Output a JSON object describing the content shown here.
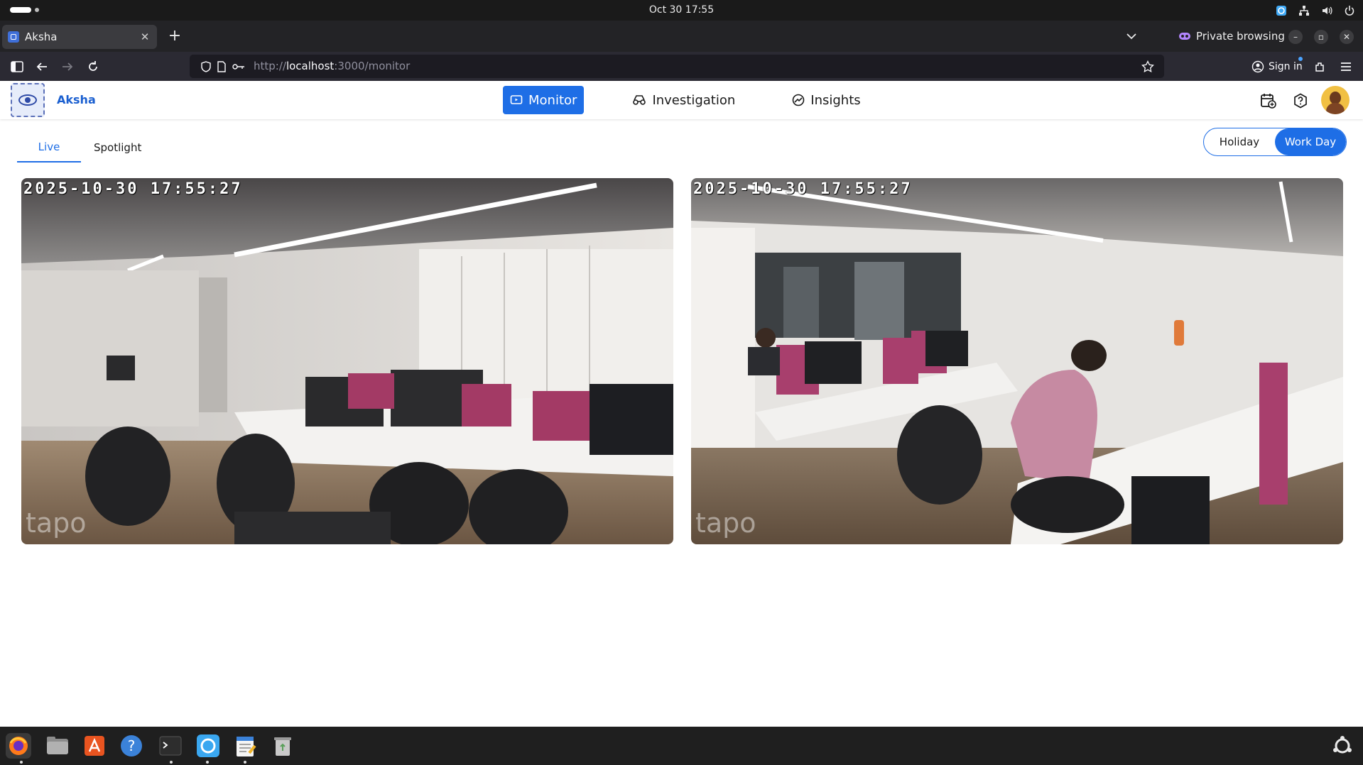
{
  "os": {
    "clock": "Oct 30  17:55"
  },
  "browser": {
    "tab_title": "Aksha",
    "tab_close": "✕",
    "new_tab": "+",
    "private_label": "Private browsing",
    "url_scheme": "http://",
    "url_host": "localhost",
    "url_rest": ":3000/monitor",
    "sign_in": "Sign in"
  },
  "app": {
    "brand": "Aksha",
    "nav": [
      {
        "label": "Monitor",
        "icon": "monitor-icon",
        "active": true
      },
      {
        "label": "Investigation",
        "icon": "investigation-icon",
        "active": false
      },
      {
        "label": "Insights",
        "icon": "insights-icon",
        "active": false
      }
    ],
    "subtabs": [
      {
        "label": "Live",
        "active": true
      },
      {
        "label": "Spotlight",
        "active": false
      }
    ],
    "schedule_toggle": {
      "options": [
        "Holiday",
        "Work Day"
      ],
      "selected": "Work Day"
    },
    "accent_color": "#1e6ee6"
  },
  "feeds": [
    {
      "timestamp": "2025-10-30 17:55:27",
      "watermark": "tapo"
    },
    {
      "timestamp": "2025-10-30 17:55:27",
      "watermark": "tapo"
    }
  ],
  "taskbar": {
    "apps": [
      "firefox-icon",
      "files-icon",
      "app-center-icon",
      "help-icon",
      "terminal-icon",
      "remote-desktop-icon",
      "text-editor-icon",
      "trash-icon"
    ],
    "show_apps": "show-apps-icon"
  }
}
